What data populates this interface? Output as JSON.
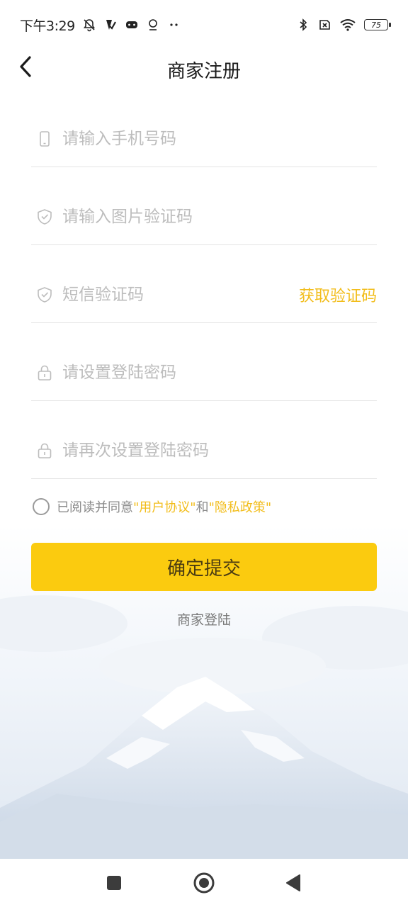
{
  "status_bar": {
    "time": "下午3:29",
    "left_icons": [
      "mute-bell-icon",
      "check-app-icon",
      "gamepad-icon",
      "location-icon",
      "more-dots-icon"
    ],
    "right_icons": [
      "bluetooth-icon",
      "no-sim-icon",
      "wifi-icon"
    ],
    "battery": "75"
  },
  "header": {
    "title": "商家注册",
    "back_icon": "chevron-left-icon"
  },
  "form": {
    "phone": {
      "placeholder": "请输入手机号码",
      "icon": "phone-icon",
      "value": ""
    },
    "image_captcha": {
      "placeholder": "请输入图片验证码",
      "icon": "shield-check-icon",
      "value": ""
    },
    "sms_code": {
      "placeholder": "短信验证码",
      "icon": "shield-check-icon",
      "value": "",
      "get_code_label": "获取验证码"
    },
    "password": {
      "placeholder": "请设置登陆密码",
      "icon": "lock-icon",
      "value": ""
    },
    "password_confirm": {
      "placeholder": "请再次设置登陆密码",
      "icon": "lock-icon",
      "value": ""
    }
  },
  "agreement": {
    "prefix": "已阅读并同意",
    "user_agreement": "\"用户协议\"",
    "conjunction": "和",
    "privacy_policy": "\"隐私政策\"",
    "checked": false
  },
  "submit_label": "确定提交",
  "login_link": "商家登陆",
  "nav_bar": {
    "recents_icon": "square-icon",
    "home_icon": "circle-home-icon",
    "back_icon": "triangle-back-icon"
  },
  "colors": {
    "accent": "#fbcb0f",
    "link": "#f2bd1b",
    "placeholder": "#bdbdbd",
    "divider": "#e4e4e4"
  }
}
